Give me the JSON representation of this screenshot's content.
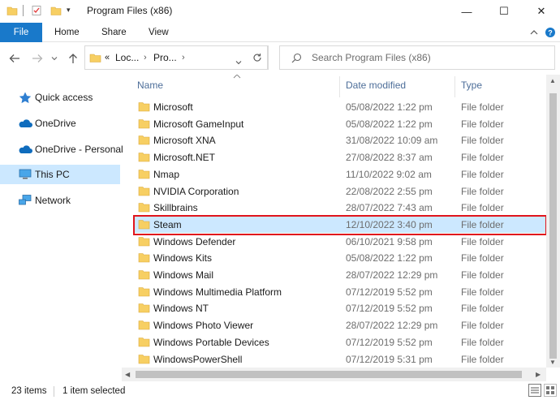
{
  "window": {
    "title": "Program Files (x86)",
    "minimize_glyph": "—",
    "maximize_glyph": "☐",
    "close_glyph": "✕"
  },
  "ribbon": {
    "tabs": [
      "File",
      "Home",
      "Share",
      "View"
    ],
    "accent_color": "#1979ca"
  },
  "navigation": {
    "address_overflow": "«",
    "breadcrumb": [
      "Loc...",
      "Pro..."
    ],
    "search_placeholder": "Search Program Files (x86)"
  },
  "sidebar": {
    "items": [
      {
        "label": "Quick access",
        "icon": "star-icon"
      },
      {
        "label": "OneDrive",
        "icon": "cloud-icon"
      },
      {
        "label": "OneDrive - Personal",
        "icon": "cloud-icon"
      },
      {
        "label": "This PC",
        "icon": "computer-icon",
        "selected": true
      },
      {
        "label": "Network",
        "icon": "network-icon"
      }
    ]
  },
  "file_list": {
    "columns": [
      "Name",
      "Date modified",
      "Type"
    ],
    "rows": [
      {
        "name": "Microsoft",
        "date": "05/08/2022 1:22 pm",
        "type": "File folder"
      },
      {
        "name": "Microsoft GameInput",
        "date": "05/08/2022 1:22 pm",
        "type": "File folder"
      },
      {
        "name": "Microsoft XNA",
        "date": "31/08/2022 10:09 am",
        "type": "File folder"
      },
      {
        "name": "Microsoft.NET",
        "date": "27/08/2022 8:37 am",
        "type": "File folder"
      },
      {
        "name": "Nmap",
        "date": "11/10/2022 9:02 am",
        "type": "File folder"
      },
      {
        "name": "NVIDIA Corporation",
        "date": "22/08/2022 2:55 pm",
        "type": "File folder"
      },
      {
        "name": "Skillbrains",
        "date": "28/07/2022 7:43 am",
        "type": "File folder"
      },
      {
        "name": "Steam",
        "date": "12/10/2022 3:40 pm",
        "type": "File folder",
        "selected": true
      },
      {
        "name": "Windows Defender",
        "date": "06/10/2021 9:58 pm",
        "type": "File folder"
      },
      {
        "name": "Windows Kits",
        "date": "05/08/2022 1:22 pm",
        "type": "File folder"
      },
      {
        "name": "Windows Mail",
        "date": "28/07/2022 12:29 pm",
        "type": "File folder"
      },
      {
        "name": "Windows Multimedia Platform",
        "date": "07/12/2019 5:52 pm",
        "type": "File folder"
      },
      {
        "name": "Windows NT",
        "date": "07/12/2019 5:52 pm",
        "type": "File folder"
      },
      {
        "name": "Windows Photo Viewer",
        "date": "28/07/2022 12:29 pm",
        "type": "File folder"
      },
      {
        "name": "Windows Portable Devices",
        "date": "07/12/2019 5:52 pm",
        "type": "File folder"
      },
      {
        "name": "WindowsPowerShell",
        "date": "07/12/2019 5:31 pm",
        "type": "File folder"
      }
    ],
    "highlight_color": "#e0151c"
  },
  "status_bar": {
    "item_count": "23 items",
    "selection": "1 item selected"
  }
}
